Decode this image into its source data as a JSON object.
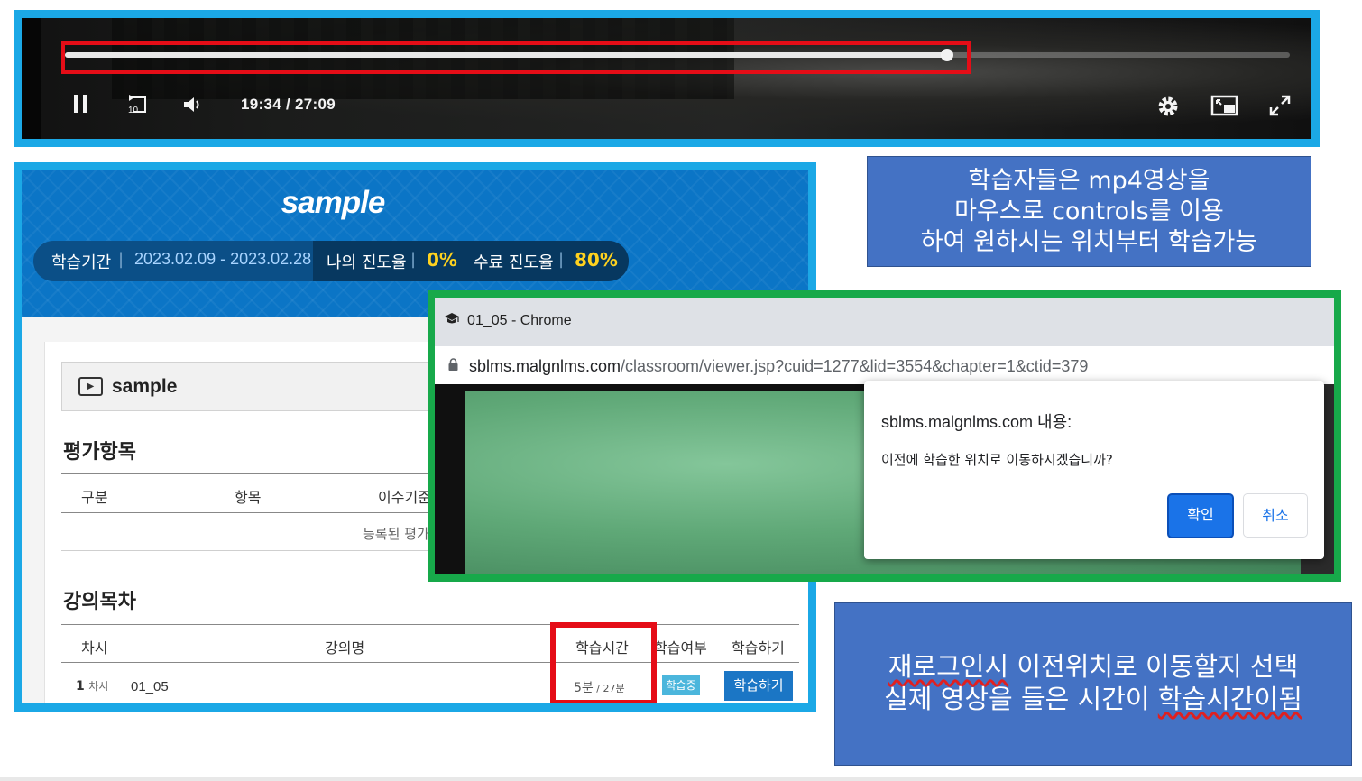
{
  "player": {
    "time": "19:34  /  27:09",
    "progress_fraction": 0.72,
    "icons": [
      "pause-icon",
      "rewind-10-icon",
      "volume-icon",
      "settings-icon",
      "pip-icon",
      "fullscreen-icon"
    ]
  },
  "lms": {
    "title": "sample",
    "period_label": "학습기간",
    "period_value": "2023.02.09 - 2023.02.28",
    "my_progress_label": "나의 진도율",
    "my_progress_value": "0%",
    "complete_label": "수료 진도율",
    "complete_value": "80%",
    "course_title": "sample",
    "eval_section": "평가항목",
    "eval_headers": [
      "구분",
      "항목",
      "이수기준"
    ],
    "eval_empty": "등록된 평가",
    "lecture_section": "강의목차",
    "lecture_headers": [
      "차시",
      "강의명",
      "학습시간",
      "학습여부",
      "학습하기"
    ],
    "row": {
      "session_no": "1",
      "session_unit": "차시",
      "lecture_name": "01_05",
      "study_time_main": "5분",
      "study_time_total": " / 27분",
      "status": "학습중",
      "action": "학습하기"
    }
  },
  "callouts": {
    "top": [
      "학습자들은 mp4영상을",
      "마우스로 controls를 이용",
      "하여 원하시는 위치부터 학습가능"
    ],
    "bottom_line1_a": "재로그인시",
    "bottom_line1_b": " 이전위치로 이동할지 선택",
    "bottom_line2_a": "실제 영상을 들은 시간이 ",
    "bottom_line2_b": "학습시간이됨"
  },
  "chrome": {
    "window_title": "01_05 - Chrome",
    "url_host": "sblms.malgnlms.com",
    "url_path": "/classroom/viewer.jsp?cuid=1277&lid=3554&chapter=1&ctid=379",
    "dialog_origin": "sblms.malgnlms.com 내용:",
    "dialog_message": "이전에 학습한 위치로 이동하시겠습니까?",
    "ok_label": "확인",
    "cancel_label": "취소"
  },
  "colors": {
    "frame_blue": "#1ba8e6",
    "frame_green": "#17a94a",
    "highlight_red": "#e50d17",
    "callout_blue": "#4472c4",
    "progress_yellow": "#ffd21f"
  }
}
